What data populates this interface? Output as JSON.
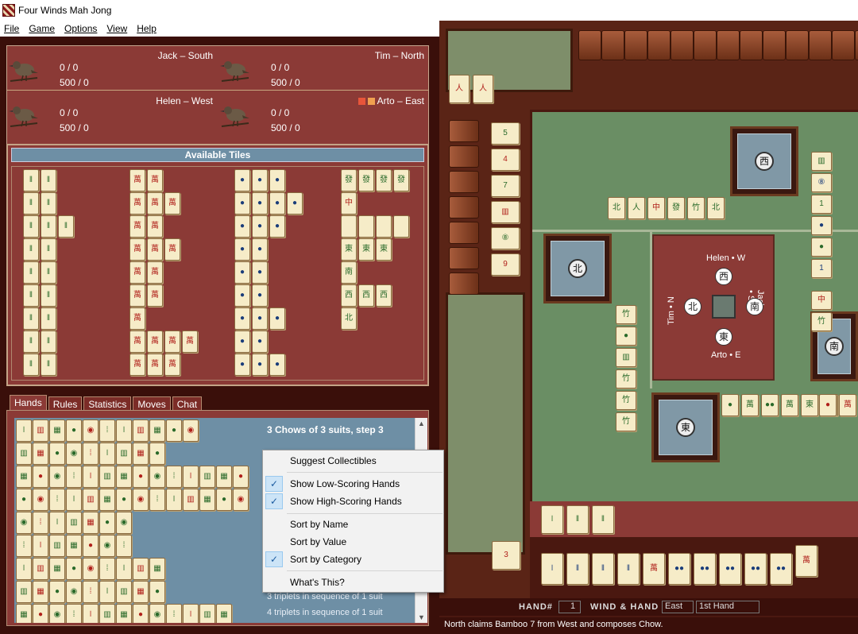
{
  "window": {
    "title": "Four Winds Mah Jong",
    "icon": "mahjong-app-icon"
  },
  "menu": [
    {
      "label": "File",
      "key": "F"
    },
    {
      "label": "Game",
      "key": "G"
    },
    {
      "label": "Options",
      "key": "O"
    },
    {
      "label": "View",
      "key": "V"
    },
    {
      "label": "Help",
      "key": "H"
    }
  ],
  "players": [
    {
      "name": "Jack – South",
      "score1": "0 / 0",
      "score2": "500 / 0"
    },
    {
      "name": "Tim – North",
      "score1": "0 / 0",
      "score2": "500 / 0"
    },
    {
      "name": "Helen – West",
      "score1": "0 / 0",
      "score2": "500 / 0"
    },
    {
      "name": "Arto – East",
      "score1": "0 / 0",
      "score2": "500 / 0",
      "indicator_colors": [
        "#e8553a",
        "#f0a050"
      ]
    }
  ],
  "available_tiles": {
    "title": "Available Tiles"
  },
  "tabs": [
    "Hands",
    "Rules",
    "Statistics",
    "Moves",
    "Chat"
  ],
  "hands": {
    "title": "3 Chows of 3 suits, step 3",
    "lines": [
      "3 triplets in sequence of 1 suit",
      "4 triplets in sequence of 1 suit"
    ]
  },
  "context_menu": {
    "items": [
      {
        "label": "Suggest Collectibles",
        "checked": false
      },
      {
        "label": "Show Low-Scoring Hands",
        "checked": true
      },
      {
        "label": "Show High-Scoring Hands",
        "checked": true
      },
      {
        "label": "Sort by Name",
        "checked": false
      },
      {
        "label": "Sort by Value",
        "checked": false
      },
      {
        "label": "Sort by Category",
        "checked": true
      },
      {
        "label": "What's This?",
        "checked": false
      }
    ]
  },
  "table": {
    "center_labels": {
      "north": "Tim • N",
      "west": "Helen • W",
      "south": "Jack • S",
      "east": "Arto • E"
    },
    "center_discs": {
      "west": "西",
      "north": "北",
      "south": "南",
      "east": "東",
      "center": "𝑃"
    }
  },
  "status": {
    "hand_label": "HAND#",
    "hand_number": "1",
    "wind_hand_label": "WIND & HAND",
    "wind": "East",
    "hand_name": "1st Hand",
    "message": "North claims Bamboo 7 from West and composes Chow."
  },
  "colors": {
    "panel": "#8b3a36",
    "dark": "#3a0f0a",
    "felt": "#6a8e64",
    "list": "#6e8fa5"
  }
}
